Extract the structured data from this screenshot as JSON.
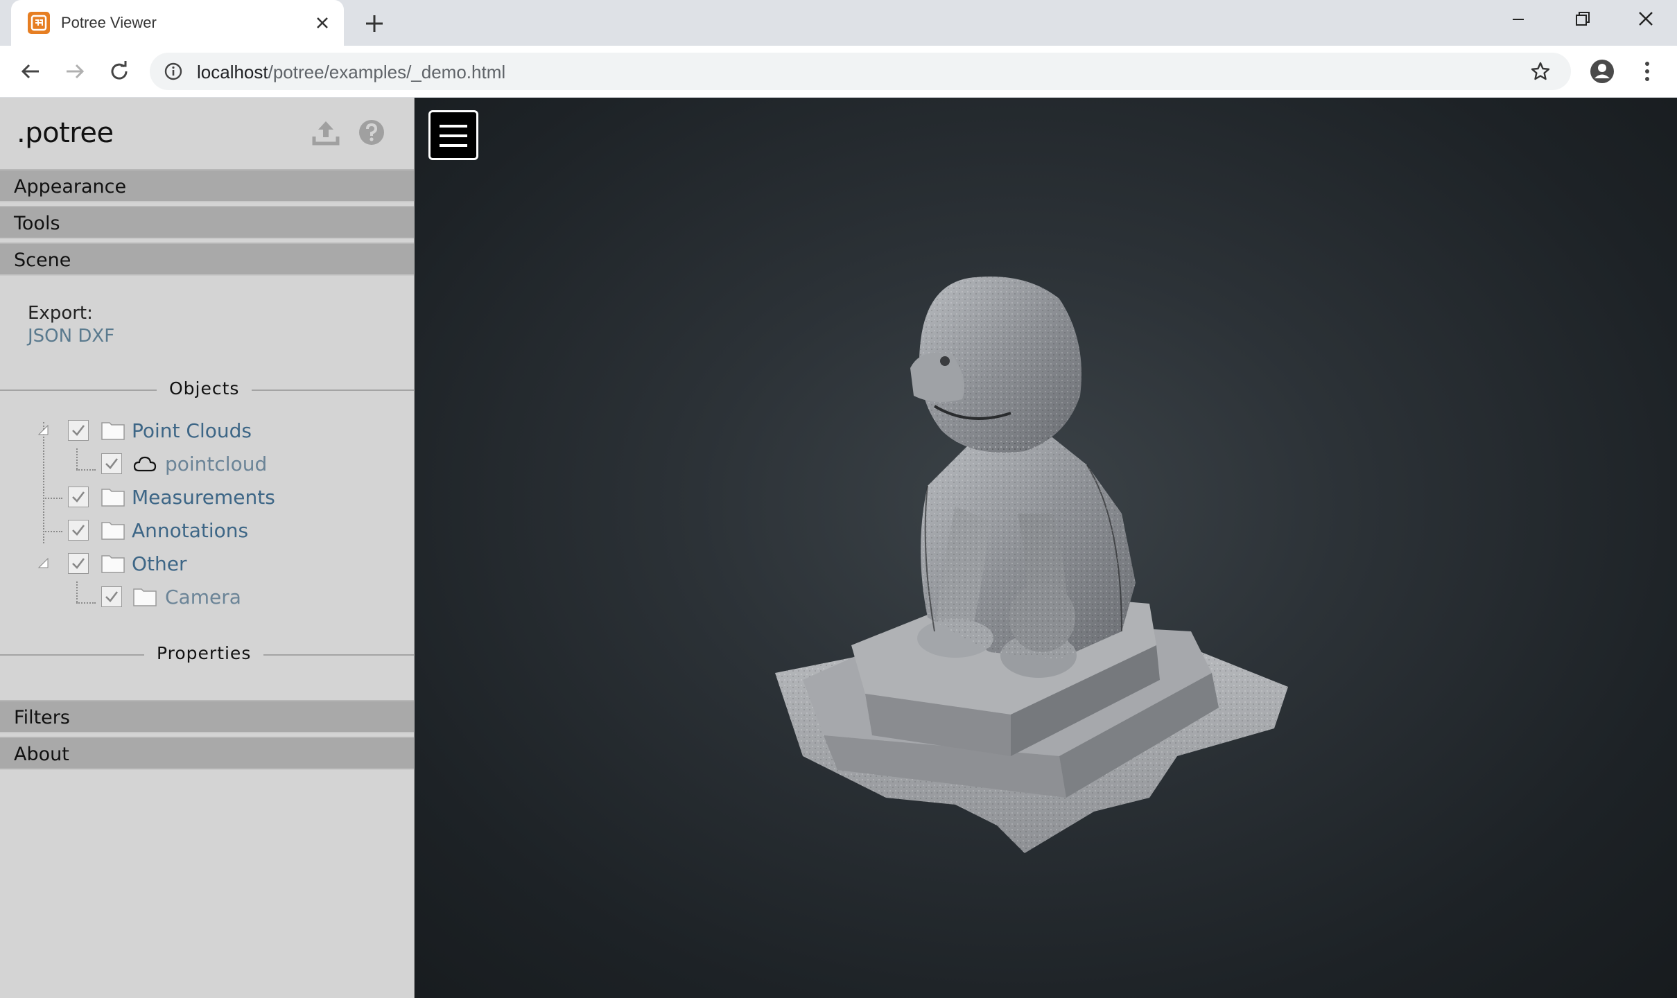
{
  "browser": {
    "tab_title": "Potree Viewer",
    "url_host": "localhost",
    "url_path": "/potree/examples/_demo.html"
  },
  "sidebar": {
    "brand": ".potree",
    "sections": {
      "appearance": "Appearance",
      "tools": "Tools",
      "scene": "Scene",
      "filters": "Filters",
      "about": "About"
    },
    "scene": {
      "export_label": "Export:",
      "export_json": "JSON",
      "export_dxf": "DXF",
      "objects_title": "Objects",
      "properties_title": "Properties",
      "tree": [
        {
          "label": "Point Clouds",
          "type": "folder",
          "checked": true,
          "expanded": true
        },
        {
          "label": "pointcloud",
          "type": "pointcloud",
          "checked": true,
          "child": true
        },
        {
          "label": "Measurements",
          "type": "folder",
          "checked": true
        },
        {
          "label": "Annotations",
          "type": "folder",
          "checked": true
        },
        {
          "label": "Other",
          "type": "folder",
          "checked": true,
          "expanded": true
        },
        {
          "label": "Camera",
          "type": "folder",
          "checked": true,
          "child": true
        }
      ]
    }
  },
  "colors": {
    "accent_link": "#3d6686",
    "sidebar_bg": "#d4d4d4",
    "section_header_bg": "#a9a9a9",
    "favicon": "#e67e22"
  }
}
